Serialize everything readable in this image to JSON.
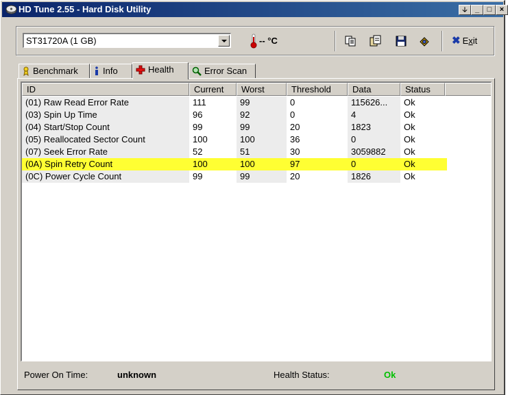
{
  "window": {
    "title": "HD Tune 2.55 - Hard Disk Utility",
    "buttons": {
      "tray": "🡣",
      "minimize": "_",
      "maximize": "□",
      "close": "×"
    }
  },
  "toolbar": {
    "drive": "ST31720A (1 GB)",
    "temperature": "-- °C",
    "exit_label_prefix": "E",
    "exit_label_accel": "x",
    "exit_label_suffix": "it",
    "icons": [
      "copy-icon",
      "copy-all-icon",
      "save-icon",
      "options-icon",
      "exit-icon"
    ]
  },
  "tabs": [
    {
      "label": "Benchmark",
      "icon": "benchmark-icon"
    },
    {
      "label": "Info",
      "icon": "info-icon"
    },
    {
      "label": "Health",
      "icon": "health-icon",
      "active": true
    },
    {
      "label": "Error Scan",
      "icon": "error-scan-icon"
    }
  ],
  "table": {
    "columns": [
      "ID",
      "Current",
      "Worst",
      "Threshold",
      "Data",
      "Status"
    ],
    "rows": [
      {
        "id": "(01) Raw Read Error Rate",
        "current": "111",
        "worst": "99",
        "threshold": "0",
        "data": "115626...",
        "status": "Ok"
      },
      {
        "id": "(03) Spin Up Time",
        "current": "96",
        "worst": "92",
        "threshold": "0",
        "data": "4",
        "status": "Ok"
      },
      {
        "id": "(04) Start/Stop Count",
        "current": "99",
        "worst": "99",
        "threshold": "20",
        "data": "1823",
        "status": "Ok"
      },
      {
        "id": "(05) Reallocated Sector Count",
        "current": "100",
        "worst": "100",
        "threshold": "36",
        "data": "0",
        "status": "Ok"
      },
      {
        "id": "(07) Seek Error Rate",
        "current": "52",
        "worst": "51",
        "threshold": "30",
        "data": "3059882",
        "status": "Ok"
      },
      {
        "id": "(0A) Spin Retry Count",
        "current": "100",
        "worst": "100",
        "threshold": "97",
        "data": "0",
        "status": "Ok",
        "highlighted": true
      },
      {
        "id": "(0C) Power Cycle Count",
        "current": "99",
        "worst": "99",
        "threshold": "20",
        "data": "1826",
        "status": "Ok"
      }
    ]
  },
  "status": {
    "power_on_label": "Power On Time:",
    "power_on_value": "unknown",
    "health_label": "Health Status:",
    "health_value": "Ok"
  },
  "colors": {
    "title_bar": "#0a246a",
    "highlight_row": "#ffff33",
    "health_ok": "#00c000",
    "thermometer": "#cc0000"
  }
}
